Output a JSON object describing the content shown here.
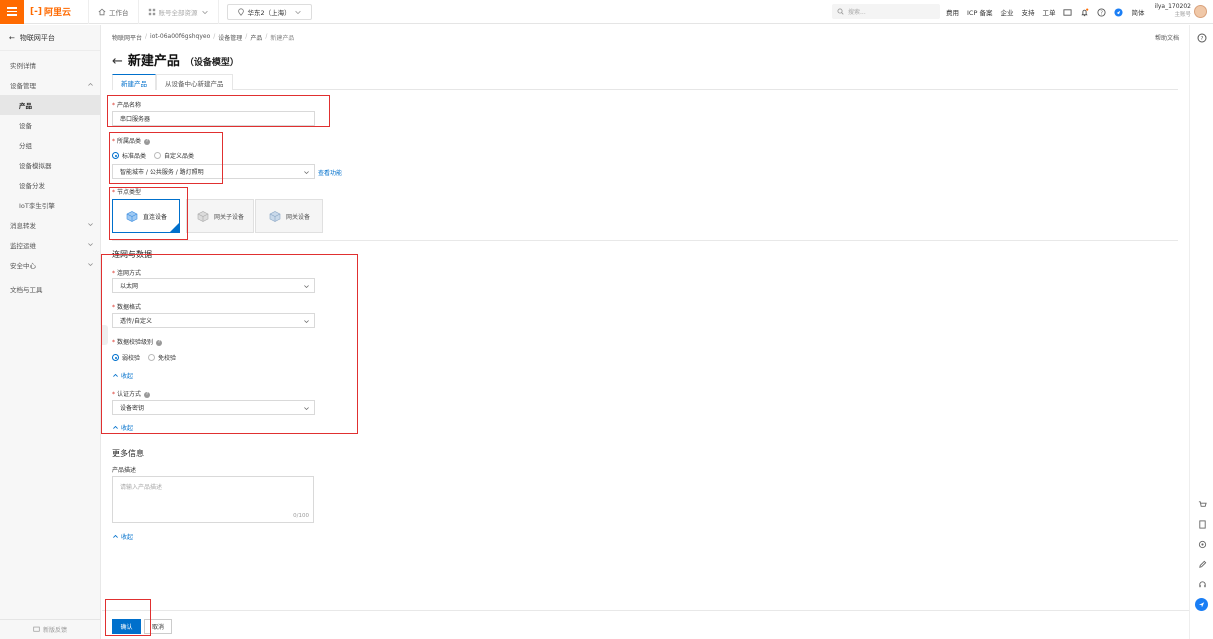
{
  "topbar": {
    "logo_text": "阿里云",
    "workbench": "工作台",
    "resource_group": "账号全部资源",
    "region": "华东2（上海）",
    "search_placeholder": "搜索...",
    "links": [
      "费用",
      "ICP 备案",
      "企业",
      "支持",
      "工单"
    ],
    "lang": "简体",
    "user_name": "ilya_170202",
    "user_role": "主账号"
  },
  "sidebar": {
    "title": "物联网平台",
    "items": [
      {
        "label": "实例详情",
        "level": 0
      },
      {
        "label": "设备管理",
        "level": 0,
        "expandable": true
      },
      {
        "label": "产品",
        "level": 1,
        "active": true
      },
      {
        "label": "设备",
        "level": 1
      },
      {
        "label": "分组",
        "level": 1
      },
      {
        "label": "设备模拟器",
        "level": 1
      },
      {
        "label": "设备分发",
        "level": 1
      },
      {
        "label": "IoT孪生引擎",
        "level": 1
      },
      {
        "label": "消息转发",
        "level": 0,
        "expandable": true
      },
      {
        "label": "监控运维",
        "level": 0,
        "expandable": true
      },
      {
        "label": "安全中心",
        "level": 0,
        "expandable": true
      },
      {
        "label": "文档与工具",
        "level": 0
      }
    ],
    "footer": "新版反馈"
  },
  "breadcrumb": [
    "物联网平台",
    "iot-06a00f6gshqyeo",
    "设备管理",
    "产品",
    "新建产品"
  ],
  "help_doc": "帮助文档",
  "page": {
    "back": "←",
    "title": "新建产品",
    "subtitle": "（设备模型）"
  },
  "tabs": [
    "新建产品",
    "从设备中心新建产品"
  ],
  "form": {
    "product_name_label": "产品名称",
    "product_name_value": "串口服务器",
    "category_label": "所属品类",
    "category_options": [
      "标准品类",
      "自定义品类"
    ],
    "category_value": "智能城市 / 公共服务 / 路灯照明",
    "view_function": "查看功能",
    "node_type_label": "节点类型",
    "node_types": [
      "直连设备",
      "网关子设备",
      "网关设备"
    ],
    "network_section": "连网与数据",
    "network_method_label": "连网方式",
    "network_method_value": "以太网",
    "data_format_label": "数据格式",
    "data_format_value": "透传/自定义",
    "check_level_label": "数据校验级别",
    "check_level_options": [
      "弱校验",
      "免校验"
    ],
    "collapse_1": "收起",
    "auth_label": "认证方式",
    "auth_value": "设备密钥",
    "collapse_2": "收起",
    "more_section": "更多信息",
    "desc_label": "产品描述",
    "desc_placeholder": "请输入产品描述",
    "desc_count": "0/100",
    "collapse_3": "收起"
  },
  "footer": {
    "confirm": "确认",
    "cancel": "取消"
  }
}
